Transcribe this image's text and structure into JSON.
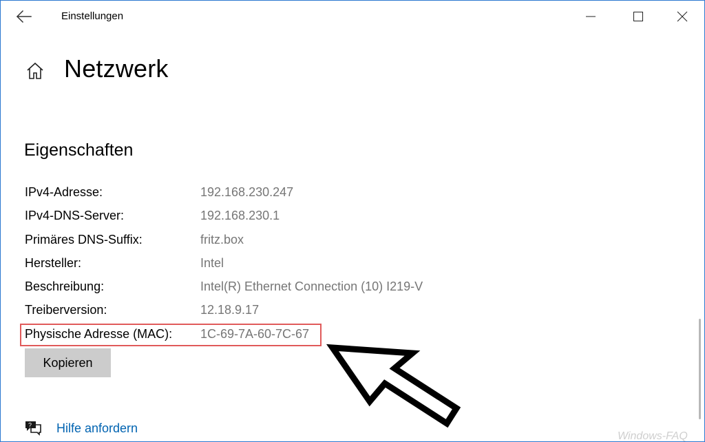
{
  "window": {
    "title": "Einstellungen"
  },
  "page": {
    "title": "Netzwerk"
  },
  "properties": {
    "heading": "Eigenschaften",
    "rows": [
      {
        "label": "IPv4-Adresse:",
        "value": "192.168.230.247"
      },
      {
        "label": "IPv4-DNS-Server:",
        "value": "192.168.230.1"
      },
      {
        "label": "Primäres DNS-Suffix:",
        "value": "fritz.box"
      },
      {
        "label": "Hersteller:",
        "value": "Intel"
      },
      {
        "label": "Beschreibung:",
        "value": "Intel(R) Ethernet Connection (10) I219-V"
      },
      {
        "label": "Treiberversion:",
        "value": "12.18.9.17"
      },
      {
        "label": "Physische Adresse (MAC):",
        "value": "1C-69-7A-60-7C-67"
      }
    ],
    "copy_label": "Kopieren"
  },
  "help": {
    "label": "Hilfe anfordern"
  },
  "watermark": "Windows-FAQ",
  "icons": {
    "back": "back-arrow-icon",
    "minimize": "minimize-icon",
    "maximize": "maximize-icon",
    "close": "close-icon",
    "home": "home-icon",
    "help": "chat-help-icon",
    "pointer": "pointer-arrow-icon"
  },
  "colors": {
    "window_border": "#2b78d0",
    "value_text": "#767676",
    "highlight": "#e05a5a",
    "link": "#0063b1",
    "button_bg": "#cccccc"
  }
}
